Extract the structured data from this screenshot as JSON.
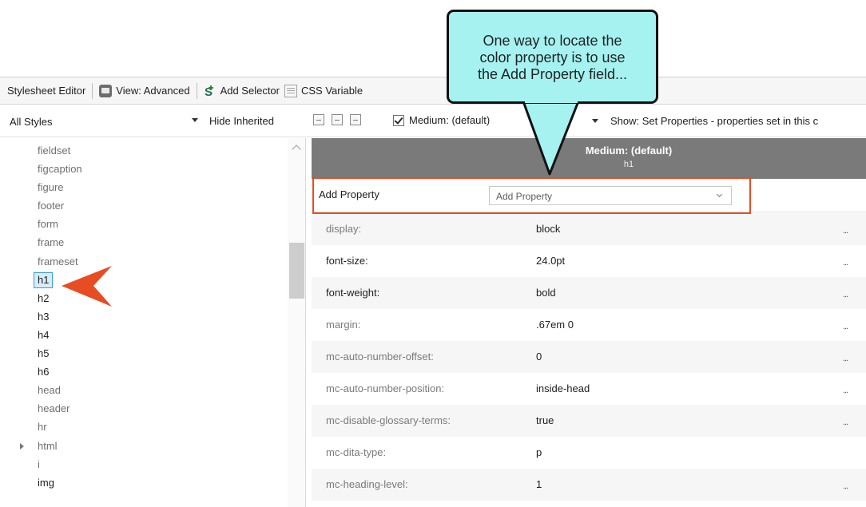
{
  "toolbar": {
    "title": "Stylesheet Editor",
    "view_label": "View: Advanced",
    "add_selector_label": "Add Selector",
    "css_variables_label": "CSS Variable"
  },
  "filterbar": {
    "styles_select_value": "All Styles",
    "hide_inherited_label": "Hide Inherited",
    "medium_label": "Medium: (default)",
    "show_label": "Show: Set Properties - properties set in this c"
  },
  "tags": [
    {
      "label": "fieldset",
      "dim": true
    },
    {
      "label": "figcaption",
      "dim": true
    },
    {
      "label": "figure",
      "dim": true
    },
    {
      "label": "footer",
      "dim": true
    },
    {
      "label": "form",
      "dim": true
    },
    {
      "label": "frame",
      "dim": true
    },
    {
      "label": "frameset",
      "dim": true
    },
    {
      "label": "h1",
      "dim": false,
      "selected": true
    },
    {
      "label": "h2",
      "dim": false
    },
    {
      "label": "h3",
      "dim": false
    },
    {
      "label": "h4",
      "dim": false
    },
    {
      "label": "h5",
      "dim": false
    },
    {
      "label": "h6",
      "dim": false
    },
    {
      "label": "head",
      "dim": true
    },
    {
      "label": "header",
      "dim": true
    },
    {
      "label": "hr",
      "dim": true
    },
    {
      "label": "html",
      "dim": true,
      "expandable": true
    },
    {
      "label": "i",
      "dim": true
    },
    {
      "label": "img",
      "dim": false
    }
  ],
  "column_header": {
    "title": "Medium: (default)",
    "subtitle": "h1"
  },
  "add_property": {
    "label": "Add Property",
    "placeholder": "Add Property"
  },
  "properties": [
    {
      "name": "display:",
      "value": "block",
      "more": "...",
      "set": false
    },
    {
      "name": "font-size:",
      "value": "24.0pt",
      "more": "...",
      "set": true
    },
    {
      "name": "font-weight:",
      "value": "bold",
      "more": "...",
      "set": true
    },
    {
      "name": "margin:",
      "value": ".67em 0",
      "more": "...",
      "set": false
    },
    {
      "name": "mc-auto-number-offset:",
      "value": "0",
      "more": "...",
      "set": false
    },
    {
      "name": "mc-auto-number-position:",
      "value": "inside-head",
      "more": "...",
      "set": false
    },
    {
      "name": "mc-disable-glossary-terms:",
      "value": "true",
      "more": "...",
      "set": false
    },
    {
      "name": "mc-dita-type:",
      "value": "p",
      "more": "",
      "set": false
    },
    {
      "name": "mc-heading-level:",
      "value": "1",
      "more": "...",
      "set": false
    }
  ],
  "callout": {
    "lines": [
      "One way to locate the",
      "color property is to use",
      "the Add Property field..."
    ]
  },
  "colors": {
    "highlight": "#e84c22",
    "callout_fill": "#a5f2f1",
    "header_bg": "#7a7a7a",
    "selection": "#d8ecfb"
  }
}
